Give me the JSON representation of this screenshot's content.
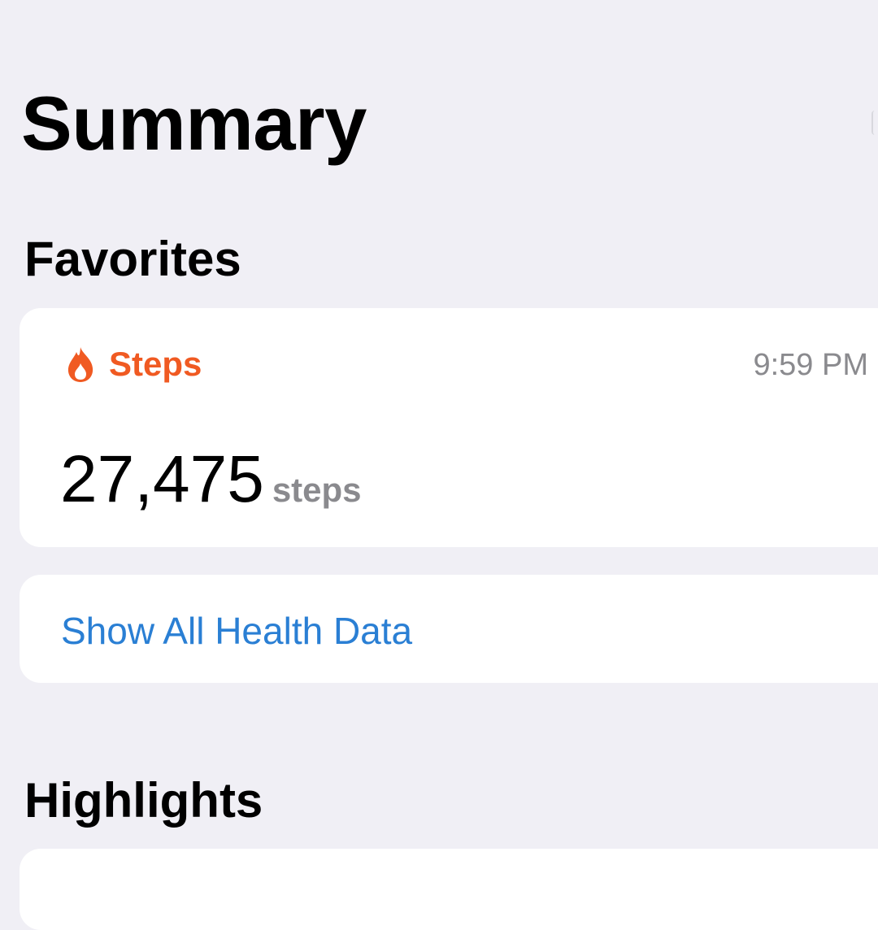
{
  "header": {
    "title": "Summary"
  },
  "favorites": {
    "section_title": "Favorites",
    "steps_card": {
      "icon": "flame-icon",
      "category": "Steps",
      "category_color": "#f05a22",
      "time": "9:59 PM",
      "value": "27,475",
      "unit": "steps"
    },
    "show_all_label": "Show All Health Data",
    "link_color": "#2a7fd4"
  },
  "highlights": {
    "section_title": "Highlights"
  },
  "colors": {
    "background": "#f0eff5",
    "card": "#ffffff",
    "secondary_text": "#8a8a8e"
  }
}
